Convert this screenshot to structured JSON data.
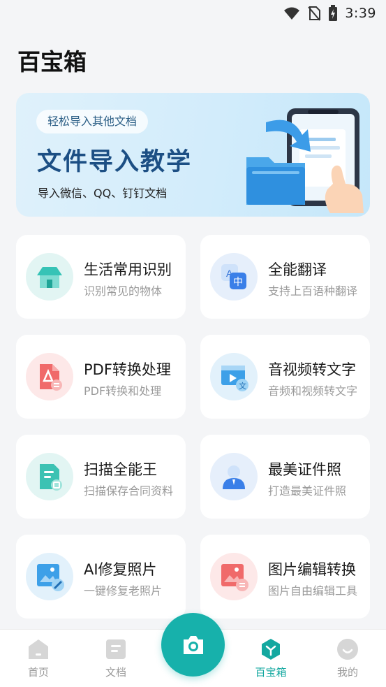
{
  "status_bar": {
    "time": "3:39"
  },
  "page": {
    "title": "百宝箱"
  },
  "banner": {
    "pill": "轻松导入其他文档",
    "title": "文件导入教学",
    "subtitle": "导入微信、QQ、钉钉文档"
  },
  "tools": [
    {
      "title": "生活常用识别",
      "desc": "识别常见的物体",
      "icon": "house-icon"
    },
    {
      "title": "全能翻译",
      "desc": "支持上百语种翻译",
      "icon": "translate-icon"
    },
    {
      "title": "PDF转换处理",
      "desc": "PDF转换和处理",
      "icon": "pdf-icon"
    },
    {
      "title": "音视频转文字",
      "desc": "音频和视频转文字",
      "icon": "video-text-icon"
    },
    {
      "title": "扫描全能王",
      "desc": "扫描保存合同资料",
      "icon": "scan-document-icon"
    },
    {
      "title": "最美证件照",
      "desc": "打造最美证件照",
      "icon": "id-photo-icon"
    },
    {
      "title": "AI修复照片",
      "desc": "一键修复老照片",
      "icon": "photo-repair-icon"
    },
    {
      "title": "图片编辑转换",
      "desc": "图片自由编辑工具",
      "icon": "image-edit-icon"
    }
  ],
  "bottom_nav": {
    "items": [
      {
        "label": "首页",
        "icon": "home-icon"
      },
      {
        "label": "文档",
        "icon": "document-icon"
      },
      {
        "label": "百宝箱",
        "icon": "toolbox-icon",
        "active": true
      },
      {
        "label": "我的",
        "icon": "profile-icon"
      }
    ],
    "fab_icon": "camera-icon"
  },
  "colors": {
    "accent": "#17b1ab",
    "active_nav": "#14a8a0",
    "banner_title": "#1c4f84"
  }
}
